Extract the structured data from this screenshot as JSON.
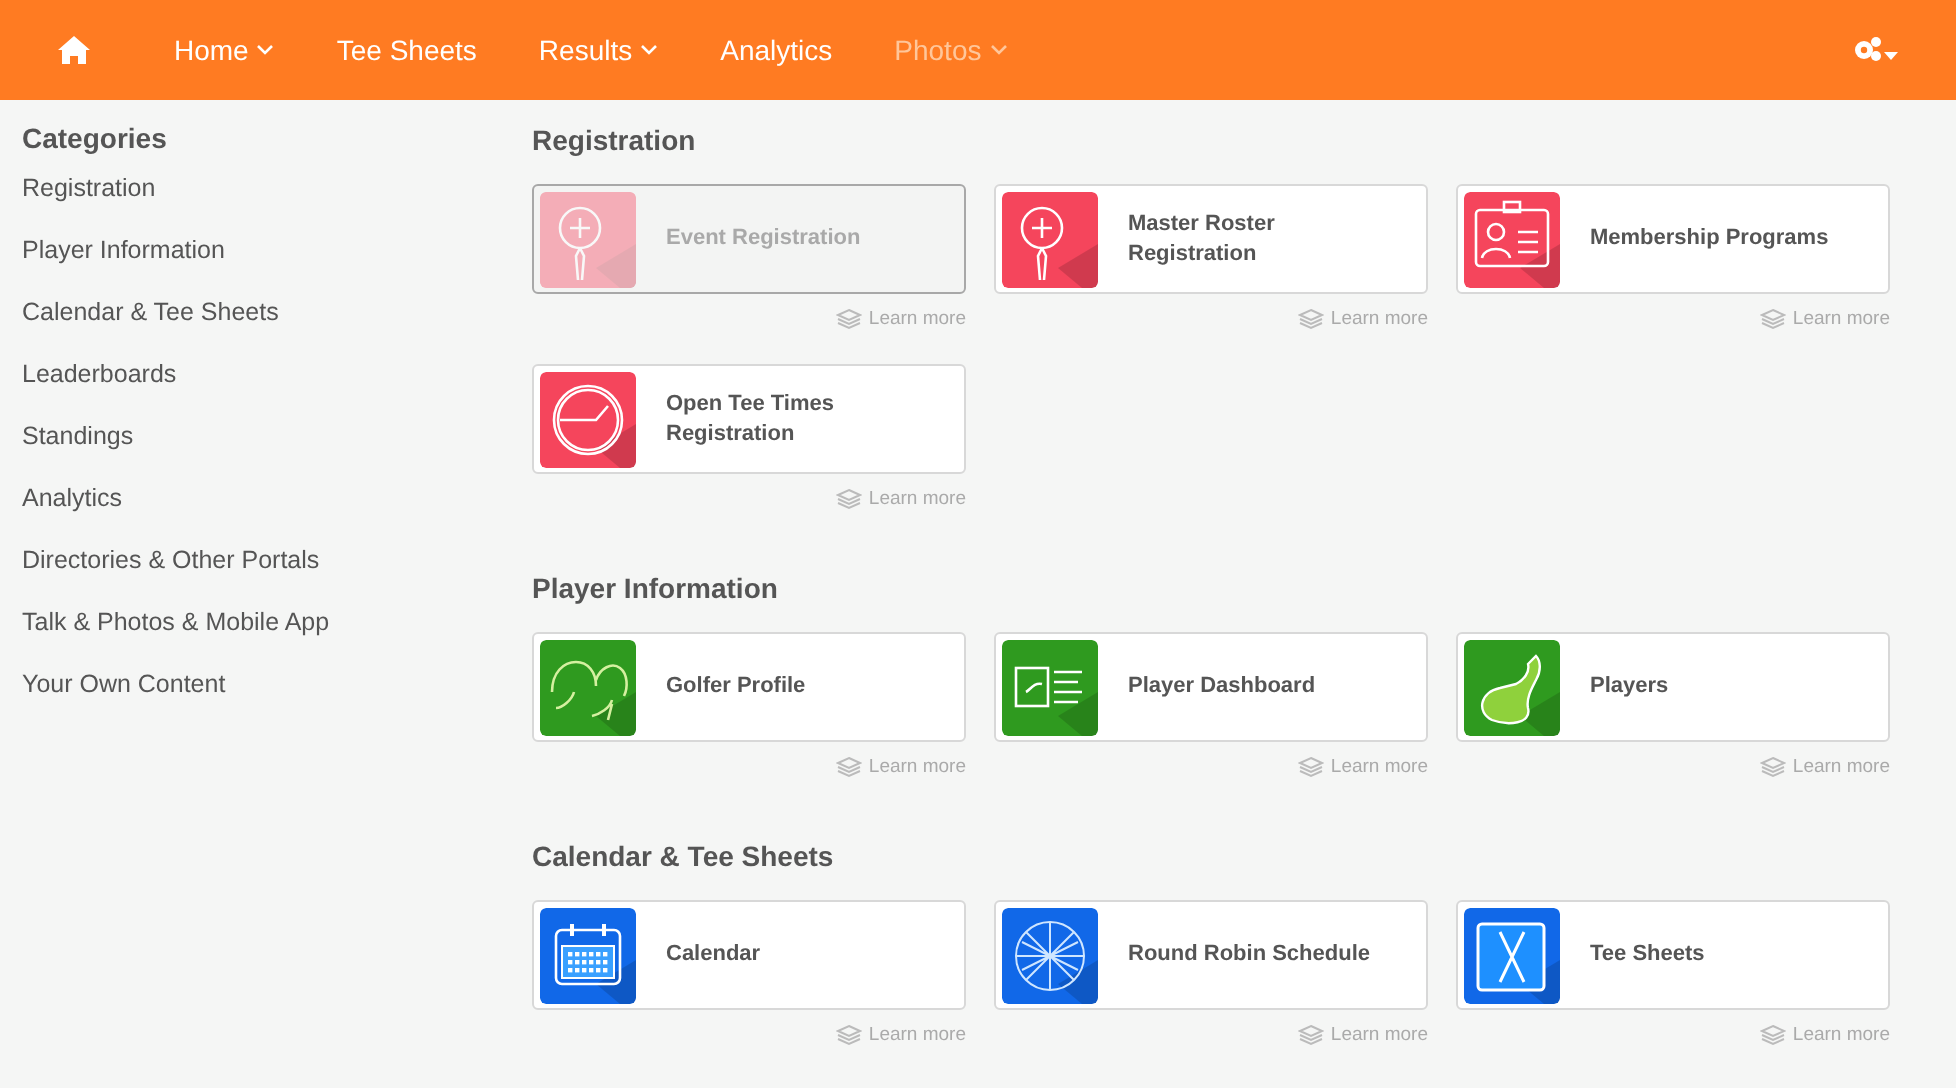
{
  "nav": {
    "items": [
      {
        "label": "Home",
        "dropdown": true,
        "disabled": false
      },
      {
        "label": "Tee Sheets",
        "dropdown": false,
        "disabled": false
      },
      {
        "label": "Results",
        "dropdown": true,
        "disabled": false
      },
      {
        "label": "Analytics",
        "dropdown": false,
        "disabled": false
      },
      {
        "label": "Photos",
        "dropdown": true,
        "disabled": true
      }
    ]
  },
  "sidebar": {
    "title": "Categories",
    "items": [
      "Registration",
      "Player Information",
      "Calendar & Tee Sheets",
      "Leaderboards",
      "Standings",
      "Analytics",
      "Directories & Other Portals",
      "Talk & Photos & Mobile App",
      "Your Own Content"
    ]
  },
  "sections": [
    {
      "title": "Registration",
      "color": "#f5455c",
      "cards": [
        {
          "label": "Event Registration",
          "disabled": true,
          "link": "Learn more"
        },
        {
          "label": "Master Roster Registration",
          "disabled": false,
          "link": "Learn more"
        },
        {
          "label": "Membership Programs",
          "disabled": false,
          "link": "Learn more"
        },
        {
          "label": "Open Tee Times Registration",
          "disabled": false,
          "link": "Learn more"
        }
      ]
    },
    {
      "title": "Player Information",
      "color": "#2f9a1f",
      "cards": [
        {
          "label": "Golfer Profile",
          "disabled": false,
          "link": "Learn more"
        },
        {
          "label": "Player Dashboard",
          "disabled": false,
          "link": "Learn more"
        },
        {
          "label": "Players",
          "disabled": false,
          "link": "Learn more"
        }
      ]
    },
    {
      "title": "Calendar & Tee Sheets",
      "color": "#1168e8",
      "cards": [
        {
          "label": "Calendar",
          "disabled": false,
          "link": "Learn more"
        },
        {
          "label": "Round Robin Schedule",
          "disabled": false,
          "link": "Learn more"
        },
        {
          "label": "Tee Sheets",
          "disabled": false,
          "link": "Learn more"
        }
      ]
    }
  ]
}
